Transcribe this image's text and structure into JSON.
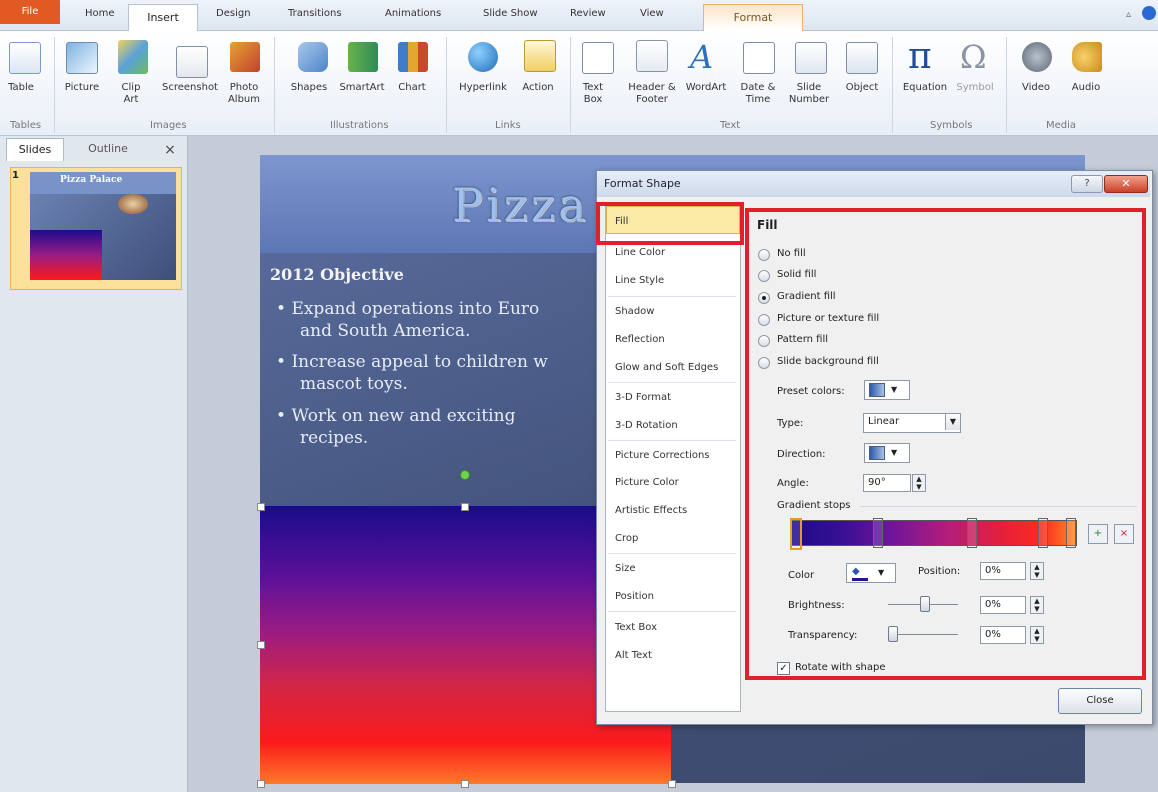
{
  "ribbon_tabs": {
    "file": "File",
    "home": "Home",
    "insert": "Insert",
    "design": "Design",
    "transitions": "Transitions",
    "animations": "Animations",
    "slide_show": "Slide Show",
    "review": "Review",
    "view": "View",
    "format": "Format"
  },
  "ribbon": {
    "table": "Table",
    "picture": "Picture",
    "clip_art": "Clip Art",
    "screenshot": "Screenshot",
    "photo_album": "Photo Album",
    "shapes": "Shapes",
    "smartart": "SmartArt",
    "chart": "Chart",
    "hyperlink": "Hyperlink",
    "action": "Action",
    "text_box": "Text Box",
    "header_footer": "Header & Footer",
    "wordart": "WordArt",
    "date_time": "Date & Time",
    "slide_number": "Slide Number",
    "object": "Object",
    "equation": "Equation",
    "symbol": "Symbol",
    "video": "Video",
    "audio": "Audio",
    "groups": {
      "tables": "Tables",
      "images": "Images",
      "illustrations": "Illustrations",
      "links": "Links",
      "text": "Text",
      "symbols": "Symbols",
      "media": "Media"
    }
  },
  "left_pane": {
    "slides_tab": "Slides",
    "outline_tab": "Outline",
    "close": "×",
    "slide_number": "1",
    "thumb_title": "Pizza Palace"
  },
  "slide": {
    "title": "Pizza",
    "heading": "2012 Objective",
    "bullets": [
      "Expand operations into Euro",
      "and South America.",
      "Increase appeal to children w",
      "mascot toys.",
      "Work on new and exciting",
      "recipes."
    ]
  },
  "dialog": {
    "title": "Format Shape",
    "help": "?",
    "close_x": "✕",
    "categories": [
      "Fill",
      "Line Color",
      "Line Style",
      "Shadow",
      "Reflection",
      "Glow and Soft Edges",
      "3-D Format",
      "3-D Rotation",
      "Picture Corrections",
      "Picture Color",
      "Artistic Effects",
      "Crop",
      "Size",
      "Position",
      "Text Box",
      "Alt Text"
    ],
    "fill": {
      "heading": "Fill",
      "options": [
        "No fill",
        "Solid fill",
        "Gradient fill",
        "Picture or texture fill",
        "Pattern fill",
        "Slide background fill"
      ],
      "selected_index": 2,
      "preset_colors_label": "Preset colors:",
      "type_label": "Type:",
      "type_value": "Linear",
      "direction_label": "Direction:",
      "angle_label": "Angle:",
      "angle_value": "90°",
      "gradient_stops_label": "Gradient stops",
      "color_label": "Color",
      "position_label": "Position:",
      "position_value": "0%",
      "brightness_label": "Brightness:",
      "brightness_value": "0%",
      "transparency_label": "Transparency:",
      "transparency_value": "0%",
      "rotate_label": "Rotate with shape",
      "rotate_checked": true
    },
    "close_button": "Close"
  }
}
